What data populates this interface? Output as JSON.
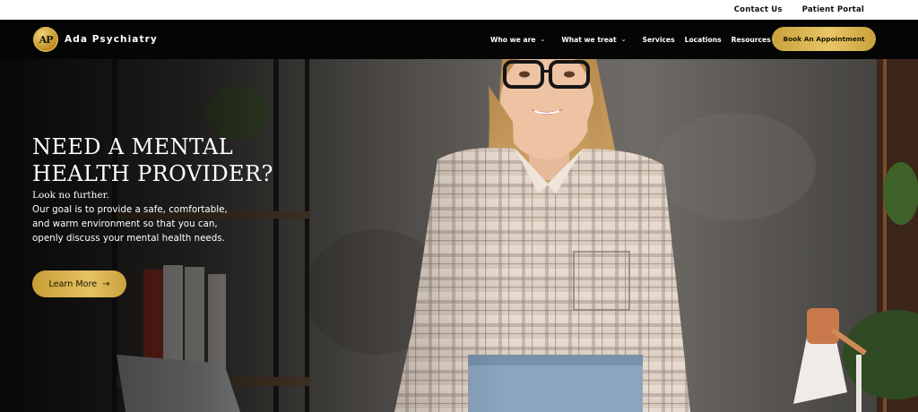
{
  "utility": {
    "contact_label": "Contact Us",
    "portal_label": "Patient Portal"
  },
  "brand": {
    "logo_initials": "AP",
    "name": "Ada Psychiatry"
  },
  "nav": {
    "items": [
      {
        "label": "Who we are",
        "has_dropdown": true
      },
      {
        "label": "What we treat",
        "has_dropdown": true
      },
      {
        "label": "Services",
        "has_dropdown": false
      },
      {
        "label": "Locations",
        "has_dropdown": false
      },
      {
        "label": "Resources",
        "has_dropdown": true
      }
    ],
    "cta_label": "Book An Appointment"
  },
  "hero": {
    "title_line1": "NEED A MENTAL",
    "title_line2": "HEALTH PROVIDER?",
    "lead": "Look no further.",
    "body_line1": "Our goal is to provide a safe, comfortable,",
    "body_line2": "and warm environment so that you can,",
    "body_line3": "openly discuss your mental health needs.",
    "button_label": "Learn More",
    "button_icon": "arrow-right-icon",
    "image": "smiling woman in plaid shirt with glasses in office"
  },
  "colors": {
    "gold": "#e0bb5a",
    "nav_bg": "#050505",
    "utility_bg": "#ffffff"
  }
}
